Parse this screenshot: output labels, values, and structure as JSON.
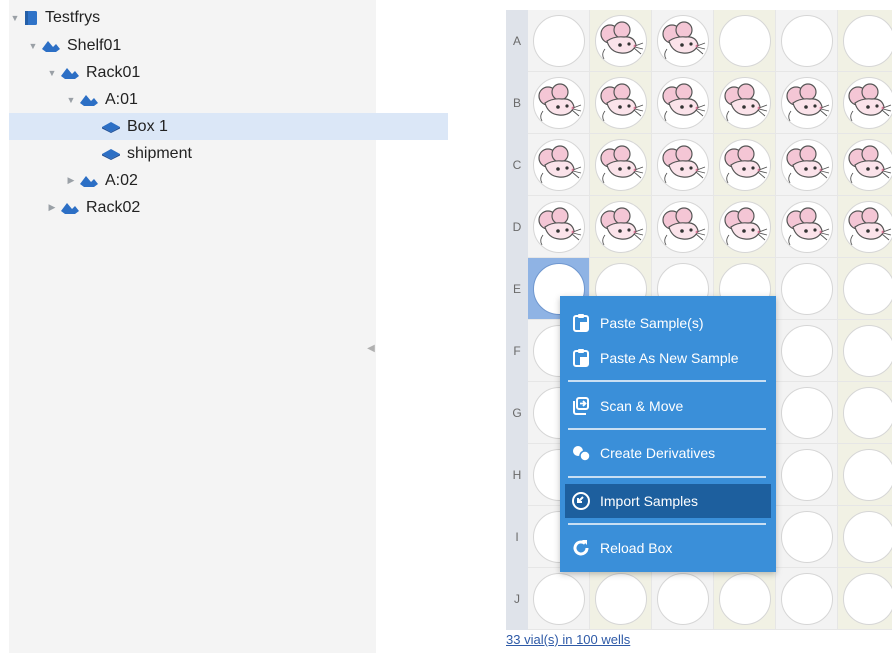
{
  "tree": {
    "nodes": [
      {
        "label": "Testfrys",
        "icon": "freezer-icon",
        "toggle": "expanded"
      },
      {
        "label": "Shelf01",
        "icon": "shelf-icon",
        "toggle": "expanded"
      },
      {
        "label": "Rack01",
        "icon": "rack-icon",
        "toggle": "expanded"
      },
      {
        "label": "A:01",
        "icon": "rack-icon",
        "toggle": "expanded"
      },
      {
        "label": "Box 1",
        "icon": "box-icon",
        "toggle": "none"
      },
      {
        "label": "shipment",
        "icon": "box-icon",
        "toggle": "none"
      },
      {
        "label": "A:02",
        "icon": "rack-icon",
        "toggle": "collapsed"
      },
      {
        "label": "Rack02",
        "icon": "rack-icon",
        "toggle": "collapsed"
      }
    ]
  },
  "grid": {
    "row_labels": [
      "A",
      "B",
      "C",
      "D",
      "E",
      "F",
      "G",
      "H",
      "I",
      "J"
    ],
    "visible_rows": [
      [
        0,
        1,
        1,
        0,
        0,
        0
      ],
      [
        1,
        1,
        1,
        1,
        1,
        1
      ],
      [
        1,
        1,
        1,
        1,
        1,
        1
      ],
      [
        1,
        1,
        1,
        1,
        1,
        1
      ],
      [
        0,
        0,
        0,
        0,
        0,
        0
      ],
      [
        0,
        0,
        0,
        0,
        0,
        0
      ],
      [
        0,
        0,
        0,
        0,
        0,
        0
      ],
      [
        0,
        0,
        0,
        0,
        0,
        0
      ],
      [
        0,
        0,
        0,
        0,
        0,
        0
      ],
      [
        0,
        0,
        0,
        0,
        0,
        0
      ]
    ],
    "selected_well": "E1",
    "summary": "33 vial(s) in 100 wells"
  },
  "context_menu": {
    "items": [
      {
        "label": "Paste Sample(s)",
        "icon": "clipboard-icon"
      },
      {
        "label": "Paste As New Sample",
        "icon": "clipboard-icon"
      },
      {
        "label": "Scan & Move",
        "icon": "scan-move-icon"
      },
      {
        "label": "Create Derivatives",
        "icon": "derivatives-icon"
      },
      {
        "label": "Import Samples",
        "icon": "import-icon"
      },
      {
        "label": "Reload Box",
        "icon": "reload-icon"
      }
    ],
    "active_item": "Import Samples"
  },
  "colors": {
    "tree_selected": "#dbe7f7",
    "menu_bg": "#3a8fd9",
    "menu_active": "#1d5f9e",
    "row_header": "#dfe3ea",
    "link": "#2e5aa7"
  }
}
